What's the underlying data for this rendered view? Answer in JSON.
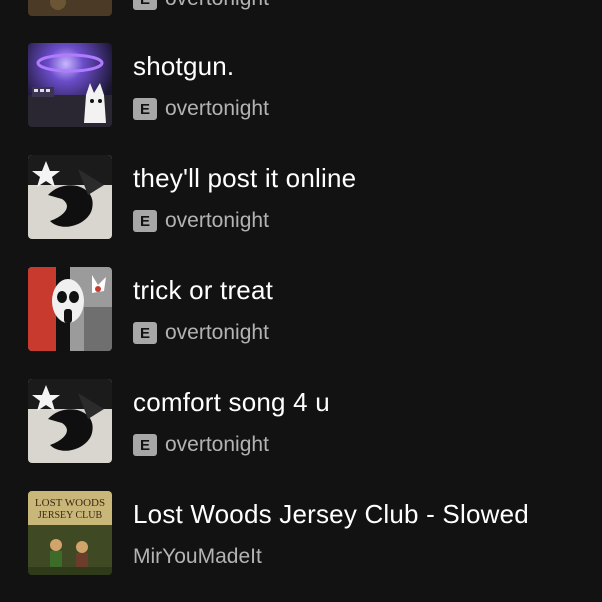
{
  "tracks": [
    {
      "title": "",
      "artist": "overtonight",
      "explicit": "E",
      "art_icon": "album-art"
    },
    {
      "title": "shotgun.",
      "artist": "overtonight",
      "explicit": "E",
      "art_icon": "album-art"
    },
    {
      "title": "they'll post it online",
      "artist": "overtonight",
      "explicit": "E",
      "art_icon": "album-art"
    },
    {
      "title": "trick or treat",
      "artist": "overtonight",
      "explicit": "E",
      "art_icon": "album-art"
    },
    {
      "title": "comfort song 4 u",
      "artist": "overtonight",
      "explicit": "E",
      "art_icon": "album-art"
    },
    {
      "title": "Lost Woods Jersey Club - Slowed",
      "artist": "MirYouMadeIt",
      "art_text": [
        "LOST WOODS",
        "JERSEY CLUB"
      ],
      "art_icon": "album-art"
    }
  ],
  "colors": {
    "background": "#121212",
    "title": "#ffffff",
    "artist": "#b3b3b3",
    "badge": "#a7a7a7"
  }
}
